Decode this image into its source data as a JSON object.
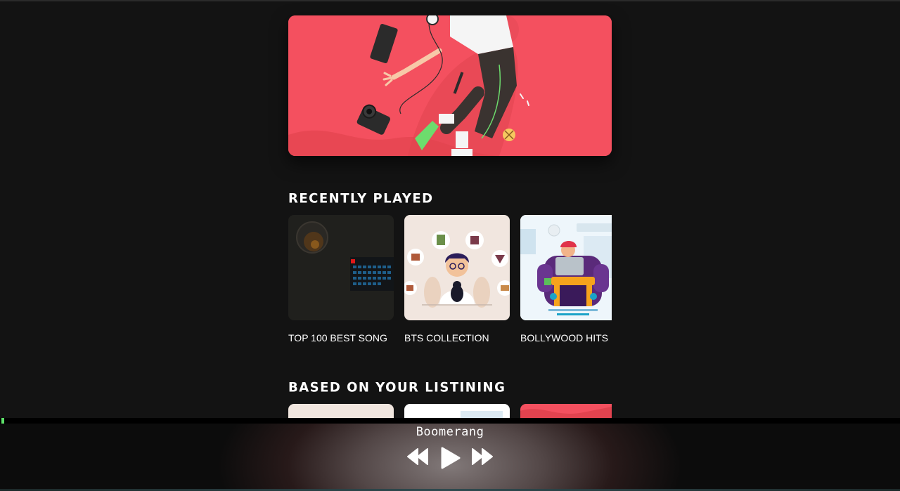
{
  "sections": {
    "recently_played": {
      "title": "RECENTLY PLAYED",
      "items": [
        {
          "label": "TOP 100 BEST SONG"
        },
        {
          "label": "BTS COLLECTION"
        },
        {
          "label": "BOLLYWOOD HITS"
        }
      ]
    },
    "based_on_listening": {
      "title": "BASED ON YOUR LISTINING"
    }
  },
  "player": {
    "track_title": "Boomerang",
    "progress": 0.003,
    "controls": {
      "prev_icon": "rewind-icon",
      "play_icon": "play-icon",
      "next_icon": "fast-forward-icon"
    }
  },
  "colors": {
    "background": "#131313",
    "hero": "#f4505f",
    "progress": "#5ee06a"
  }
}
